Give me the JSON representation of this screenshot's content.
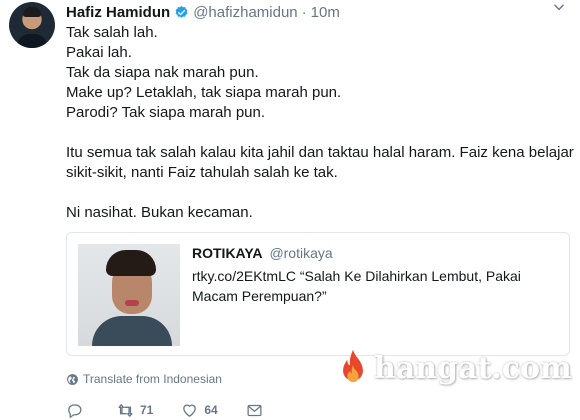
{
  "tweet": {
    "author_name": "Hafiz Hamidun",
    "handle": "@hafizhamidun",
    "separator": "·",
    "time": "10m",
    "lines": [
      "Tak salah lah.",
      "Pakai lah.",
      "Tak da siapa nak marah pun.",
      "Make up? Letaklah, tak siapa marah pun.",
      "Parodi? Tak siapa marah pun.",
      "",
      "Itu semua tak salah kalau kita jahil dan taktau halal haram. Faiz kena belajar",
      "sikit-sikit, nanti Faiz tahulah salah ke tak.",
      "",
      "Ni nasihat. Bukan kecaman."
    ],
    "quoted": {
      "name": "ROTIKAYA",
      "handle": "@rotikaya",
      "line1": "rtky.co/2EKtmLC “Salah Ke Dilahirkan Lembut, Pakai",
      "line2": "Macam Perempuan?”"
    },
    "translate_label": "Translate from Indonesian",
    "actions": {
      "reply_count": "",
      "retweet_count": "71",
      "like_count": "64"
    }
  },
  "watermark_text": "hangat.com",
  "colors": {
    "text": "#14171a",
    "secondary": "#657786",
    "verified_blue": "#1da1f2",
    "border": "#e1e8ed",
    "watermark_flame": "#e8472b"
  },
  "icons": [
    "verified-badge-icon",
    "chevron-down-icon",
    "globe-icon",
    "reply-icon",
    "retweet-icon",
    "heart-icon",
    "message-icon",
    "flame-icon"
  ]
}
